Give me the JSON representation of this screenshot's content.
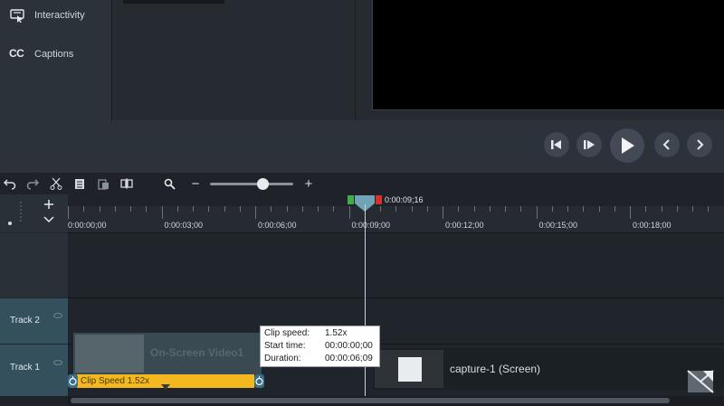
{
  "tools": {
    "interactivity_label": "Interactivity",
    "captions_label": "Captions",
    "captions_glyph": "CC"
  },
  "timeline": {
    "playhead_time": "0:00:09;16",
    "ruler_labels": [
      "0:00:00;00",
      "0:00:03;00",
      "0:00:06;00",
      "0:00:09;00",
      "0:00:12;00",
      "0:00:15;00",
      "0:00:18;00"
    ],
    "zoom_minus": "−",
    "zoom_plus": "+"
  },
  "tracks": {
    "track2_label": "Track 2",
    "track1_label": "Track 1"
  },
  "clips": {
    "video_clip_label": "On-Screen Video1",
    "speed_bar_label": "Clip Speed 1.52x",
    "screen_clip_label": "capture-1 (Screen)"
  },
  "tooltip": {
    "clip_speed_key": "Clip speed:",
    "clip_speed_val": "1.52x",
    "start_time_key": "Start time:",
    "start_time_val": "00:00:00;00",
    "duration_key": "Duration:",
    "duration_val": "00:00:06;09"
  },
  "colors": {
    "speed_bar": "#f2b81d",
    "track_header": "#33505c",
    "playhead_green": "#3fae49",
    "playhead_red": "#d6312d"
  }
}
